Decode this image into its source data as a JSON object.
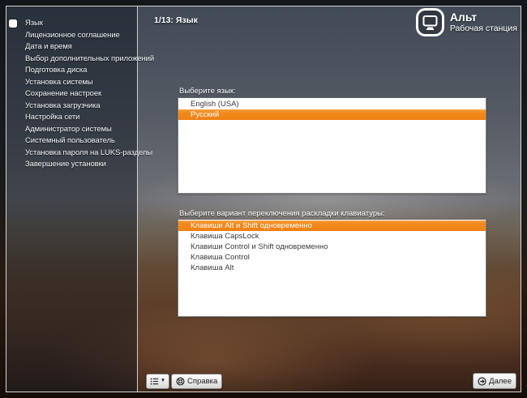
{
  "header": {
    "step_title": "1/13: Язык",
    "brand_name": "Альт",
    "brand_subtitle": "Рабочая станция"
  },
  "sidebar": {
    "items": [
      {
        "label": "Язык",
        "active": true
      },
      {
        "label": "Лицензионное соглашение",
        "active": false
      },
      {
        "label": "Дата и время",
        "active": false
      },
      {
        "label": "Выбор дополнительных приложений",
        "active": false
      },
      {
        "label": "Подготовка диска",
        "active": false
      },
      {
        "label": "Установка системы",
        "active": false
      },
      {
        "label": "Сохранение настроек",
        "active": false
      },
      {
        "label": "Установка загрузчика",
        "active": false
      },
      {
        "label": "Настройка сети",
        "active": false
      },
      {
        "label": "Администратор системы",
        "active": false
      },
      {
        "label": "Системный пользователь",
        "active": false
      },
      {
        "label": "Установка пароля на LUKS-разделы",
        "active": false
      },
      {
        "label": "Завершение установки",
        "active": false
      }
    ]
  },
  "language_section": {
    "label": "Выберите язык:",
    "options": [
      {
        "label": "English (USA)",
        "selected": false
      },
      {
        "label": "Русский",
        "selected": true
      }
    ]
  },
  "keyboard_section": {
    "label": "Выберите вариант переключения раскладки клавиатуры:",
    "options": [
      {
        "label": "Клавиши Alt и Shift одновременно",
        "selected": true
      },
      {
        "label": "Клавиша CapsLock",
        "selected": false
      },
      {
        "label": "Клавиши Control и Shift одновременно",
        "selected": false
      },
      {
        "label": "Клавиша Control",
        "selected": false
      },
      {
        "label": "Клавиша Alt",
        "selected": false
      }
    ]
  },
  "footer": {
    "help_label": "Справка",
    "next_label": "Далее"
  },
  "icons": {
    "logo": "alt-monitor-icon",
    "menu": "list-menu-icon",
    "menu_caret": "chevron-down-icon",
    "help": "lifebuoy-icon",
    "next": "circle-arrow-right-icon"
  },
  "colors": {
    "accent_orange": "#F28A1E",
    "selected_text": "#FFFFFF",
    "listbox_background": "#FFFFFF"
  }
}
